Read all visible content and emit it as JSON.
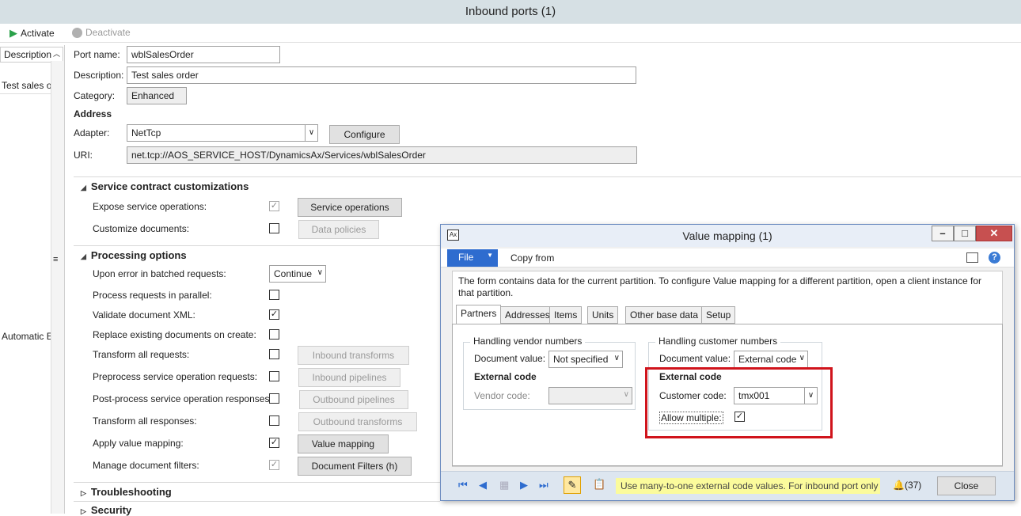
{
  "window": {
    "title": "Inbound ports (1)"
  },
  "toolbar": {
    "activate": "Activate",
    "deactivate": "Deactivate"
  },
  "grid": {
    "column_header": "Description",
    "row1": "Test sales or",
    "row2": "Automatic E"
  },
  "form": {
    "port_name_label": "Port name:",
    "port_name_value": "wblSalesOrder",
    "description_label": "Description:",
    "description_value": "Test sales order",
    "category_label": "Category:",
    "category_value": "Enhanced",
    "address_heading": "Address",
    "adapter_label": "Adapter:",
    "adapter_value": "NetTcp",
    "configure_button": "Configure",
    "uri_label": "URI:",
    "uri_value": "net.tcp://AOS_SERVICE_HOST/DynamicsAx/Services/wblSalesOrder"
  },
  "service_contract": {
    "title": "Service contract customizations",
    "expose_label": "Expose service operations:",
    "service_operations_button": "Service operations",
    "customize_label": "Customize documents:",
    "data_policies_button": "Data policies"
  },
  "processing": {
    "title": "Processing options",
    "error_label": "Upon error in batched requests:",
    "error_value": "Continue",
    "parallel_label": "Process requests in parallel:",
    "validate_label": "Validate document XML:",
    "replace_label": "Replace existing documents on create:",
    "transform_req_label": "Transform all requests:",
    "inbound_transforms_button": "Inbound transforms",
    "preprocess_label": "Preprocess service operation requests:",
    "inbound_pipelines_button": "Inbound pipelines",
    "postprocess_label": "Post-process service operation responses:",
    "outbound_pipelines_button": "Outbound pipelines",
    "transform_resp_label": "Transform all responses:",
    "outbound_transforms_button": "Outbound transforms",
    "value_mapping_label": "Apply value mapping:",
    "value_mapping_button": "Value mapping",
    "filters_label": "Manage document filters:",
    "filters_button": "Document Filters (h)"
  },
  "sections": {
    "troubleshooting": "Troubleshooting",
    "security": "Security"
  },
  "dialog": {
    "title": "Value mapping (1)",
    "file_menu": "File",
    "copy_from": "Copy from",
    "info": "The form contains data for the current partition. To configure Value mapping for a different partition, open a client instance for that partition.",
    "tabs": [
      "Partners",
      "Addresses",
      "Items",
      "Units",
      "Other base data",
      "Setup"
    ],
    "vendor": {
      "title": "Handling vendor numbers",
      "doc_value_label": "Document value:",
      "doc_value": "Not specified",
      "external_code_heading": "External code",
      "vendor_code_label": "Vendor code:"
    },
    "customer": {
      "title": "Handling customer numbers",
      "doc_value_label": "Document value:",
      "doc_value": "External code",
      "external_code_heading": "External code",
      "customer_code_label": "Customer code:",
      "customer_code_value": "tmx001",
      "allow_multiple_label": "Allow multiple:"
    },
    "status_text": "Use many-to-one external code values. For inbound port only",
    "notifications": "(37)",
    "close_button": "Close"
  },
  "colors": {
    "highlight_box": "#d0141c",
    "status_bg": "#fbfb9c",
    "accent_blue": "#3a7bd5"
  }
}
